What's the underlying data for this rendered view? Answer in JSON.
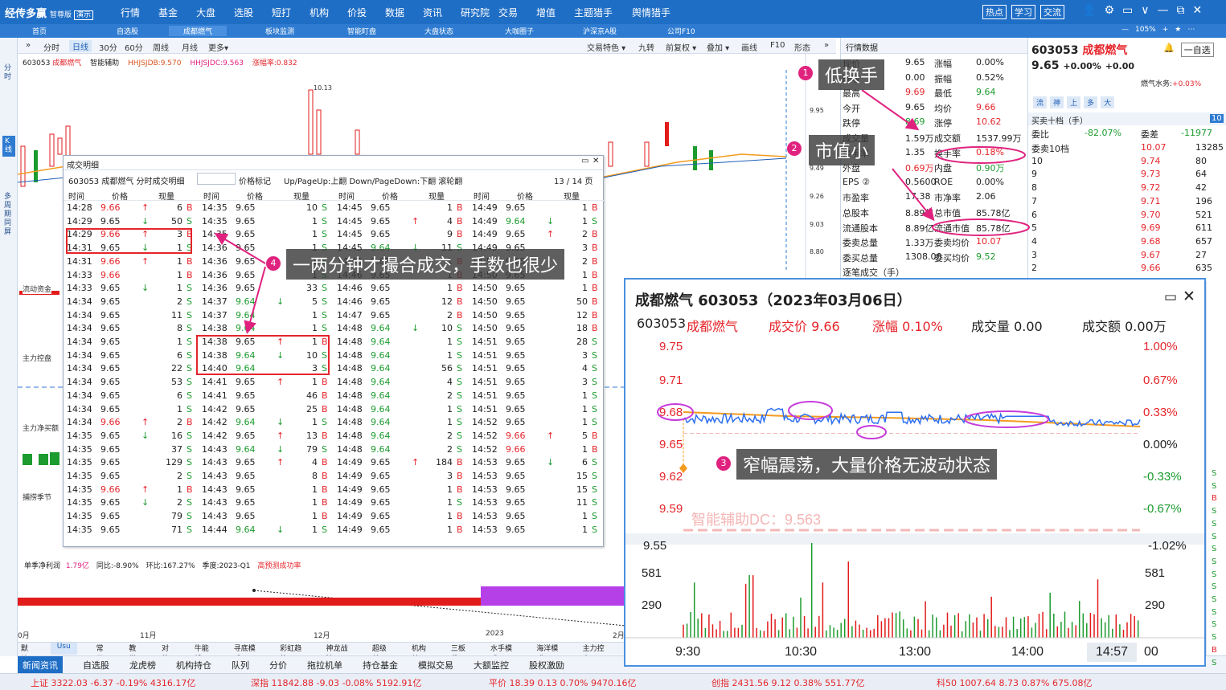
{
  "app": {
    "logo": "经传多赢",
    "edition": "智尊版",
    "demo": "演示"
  },
  "mainmenu": [
    "行情",
    "基金",
    "大盘",
    "选股",
    "短打",
    "机构",
    "价投",
    "数据",
    "资讯",
    "研究院",
    "交易",
    "增值",
    "主题猎手",
    "舆情猎手"
  ],
  "topright": [
    "热点",
    "学习",
    "交流"
  ],
  "wincontrols": [
    "👤",
    "⚙",
    "▭",
    "∨",
    "—",
    "⧉",
    "✕"
  ],
  "tabs": [
    "首页",
    "自选股",
    "成都燃气",
    "板块监测",
    "智能盯盘",
    "大盘状态",
    "大咖圈子",
    "沪深京A股",
    "公司F10"
  ],
  "zoom": "105%",
  "vleft": [
    "分时",
    "K线",
    "多周期同屏"
  ],
  "charttool": {
    "nav": "»",
    "periods": [
      "分时",
      "日线",
      "30分",
      "60分",
      "周线",
      "月线",
      "更多▾"
    ],
    "right": [
      "交易特色 ▾",
      "九转",
      "前复权 ▾",
      "叠加 ▾",
      "画线",
      "F10",
      "形态",
      "»"
    ]
  },
  "stockline": {
    "code": "603053",
    "name": "成都燃气",
    "assist": "智能辅助",
    "hj1": "HHJSJDB:9.570",
    "hj2": "HHJSJDC:9.563",
    "rate": "涨幅率:0.832"
  },
  "chartaxis": {
    "price_high": "10.13",
    "yticks": [
      "9.95",
      "9.49",
      "9.26",
      "9.03",
      "8.80"
    ],
    "months": [
      "0月",
      "11月",
      "12月",
      "2023",
      "2月"
    ]
  },
  "chartlabels": [
    "流动资金",
    "主力控盘",
    "主力净买额",
    "捕捞季节"
  ],
  "finline": {
    "a": "单季净利润",
    "b": "1.79亿",
    "c": "同比:-8.90%",
    "d": "环比:167.27%",
    "e": "季度:2023-Q1",
    "f": "高预测成功率"
  },
  "btabs": [
    "默认",
    "Usu",
    "常用",
    "教学",
    "对外",
    "牛能线",
    "寻底模式",
    "彩虹趋势",
    "神龙战法",
    "超级单",
    "机构单",
    "三板斧",
    "水手模式",
    "海洋模式",
    "主力控盘"
  ],
  "newsbar": [
    "新闻资讯",
    "自选股",
    "龙虎榜",
    "机构持仓",
    "队列",
    "分价",
    "拖拉机单",
    "持仓基金",
    "模拟交易",
    "大额监控",
    "股权激励"
  ],
  "status": [
    {
      "name": "上证",
      "v": "3322.03",
      "c": "-6.37",
      "p": "-0.19%",
      "a": "4316.17亿"
    },
    {
      "name": "深指",
      "v": "11842.88",
      "c": "-9.03",
      "p": "-0.08%",
      "a": "5192.91亿"
    },
    {
      "name": "平价",
      "v": "18.39",
      "c": "0.13",
      "p": "0.70%",
      "a": "9470.16亿"
    },
    {
      "name": "创指",
      "v": "2431.56",
      "c": "9.12",
      "p": "0.38%",
      "a": "551.77亿"
    },
    {
      "name": "科50",
      "v": "1007.64",
      "c": "8.73",
      "p": "0.87%",
      "a": "675.08亿"
    }
  ],
  "quote": {
    "head": "行情数据",
    "rows": [
      [
        "现价",
        "9.65",
        "涨幅",
        "0.00%"
      ],
      [
        "昨收",
        "0.00",
        "振幅",
        "0.52%"
      ],
      [
        "最高",
        "9.69",
        "最低",
        "9.64"
      ],
      [
        "今开",
        "9.65",
        "均价",
        "9.66"
      ],
      [
        "跌停",
        "8.69",
        "涨停",
        "10.62"
      ],
      [
        "成交量",
        "1.59万",
        "成交额",
        "1537.99万"
      ],
      [
        "换手率",
        "1.35",
        "换手率",
        "0.18%"
      ],
      [
        "外盘",
        "0.69万",
        "内盘",
        "0.90万"
      ],
      [
        "EPS ②",
        "0.5600",
        "ROE",
        "0.00%"
      ],
      [
        "市盈率",
        "17.38",
        "市净率",
        "2.06"
      ],
      [
        "总股本",
        "8.89亿",
        "总市值",
        "85.78亿"
      ],
      [
        "流通股本",
        "8.89亿",
        "流通市值",
        "85.78亿"
      ],
      [
        "委卖总量",
        "1.33万",
        "委卖均价",
        "10.07"
      ],
      [
        "委买总量",
        "1308.00",
        "委买均价",
        "9.52"
      ],
      [
        "逐笔成交（手）",
        "",
        "",
        ""
      ]
    ]
  },
  "right": {
    "code": "603053",
    "name": "成都燃气",
    "price": "9.65",
    "chg": "+0.00%",
    "chgv": "+0.00",
    "btn1": "🔔",
    "btn2": "一自选",
    "feed": "燃气水务:",
    "feedv": "+0.03%",
    "tabs": [
      "流",
      "神",
      "上",
      "多",
      "大"
    ],
    "obhead": "买卖十档（手）",
    "obhead_n": "10",
    "wb": "委比",
    "wbv": "-82.07%",
    "wc": "委差",
    "wcv": "-11977",
    "book": [
      [
        "委卖10档",
        "10.07",
        "13285"
      ],
      [
        "10",
        "9.74",
        "80"
      ],
      [
        "9",
        "9.73",
        "64"
      ],
      [
        "8",
        "9.72",
        "42"
      ],
      [
        "7",
        "9.71",
        "196"
      ],
      [
        "6",
        "9.70",
        "521"
      ],
      [
        "5",
        "9.69",
        "611"
      ],
      [
        "4",
        "9.68",
        "657"
      ],
      [
        "3",
        "9.67",
        "27"
      ],
      [
        "2",
        "9.66",
        "635"
      ]
    ]
  },
  "rightstrip": [
    "S",
    "S",
    "B",
    "S",
    "S",
    "S",
    "S",
    "S",
    "S",
    "S",
    "S",
    "S",
    "S",
    "S",
    "B",
    "S"
  ],
  "dlg": {
    "title": "成交明细",
    "sub": "603053 成都燃气  分时成交明细",
    "pricemark": "价格标记",
    "hint": "Up/PageUp:上翻 Down/PageDown:下翻 滚轮翻",
    "page": "13 / 14 页",
    "headers": [
      "时间",
      "价格",
      "现量"
    ],
    "cols": [
      [
        [
          "14:28",
          "9.66",
          "↑",
          "6",
          "B"
        ],
        [
          "14:29",
          "9.65",
          "↓",
          "50",
          "S"
        ],
        [
          "14:29",
          "9.66",
          "↑",
          "3",
          "B"
        ],
        [
          "14:31",
          "9.65",
          "↓",
          "1",
          "S"
        ],
        [
          "14:31",
          "9.66",
          "↑",
          "1",
          "B"
        ],
        [
          "14:33",
          "9.66",
          "",
          "1",
          "B"
        ],
        [
          "14:33",
          "9.65",
          "↓",
          "1",
          "S"
        ],
        [
          "14:34",
          "9.65",
          "",
          "2",
          "S"
        ],
        [
          "14:34",
          "9.65",
          "",
          "11",
          "S"
        ],
        [
          "14:34",
          "9.65",
          "",
          "8",
          "S"
        ],
        [
          "14:34",
          "9.65",
          "",
          "1",
          "S"
        ],
        [
          "14:34",
          "9.65",
          "",
          "6",
          "S"
        ],
        [
          "14:34",
          "9.65",
          "",
          "22",
          "S"
        ],
        [
          "14:34",
          "9.65",
          "",
          "53",
          "S"
        ],
        [
          "14:34",
          "9.65",
          "",
          "6",
          "S"
        ],
        [
          "14:34",
          "9.65",
          "",
          "1",
          "S"
        ],
        [
          "14:34",
          "9.66",
          "↑",
          "2",
          "B"
        ],
        [
          "14:35",
          "9.65",
          "↓",
          "16",
          "S"
        ],
        [
          "14:35",
          "9.65",
          "",
          "37",
          "S"
        ],
        [
          "14:35",
          "9.65",
          "",
          "129",
          "S"
        ],
        [
          "14:35",
          "9.65",
          "",
          "2",
          "S"
        ],
        [
          "14:35",
          "9.66",
          "↑",
          "1",
          "B"
        ],
        [
          "14:35",
          "9.65",
          "↓",
          "2",
          "S"
        ],
        [
          "14:35",
          "9.65",
          "",
          "79",
          "S"
        ],
        [
          "14:35",
          "9.65",
          "",
          "71",
          "S"
        ]
      ],
      [
        [
          "14:35",
          "9.65",
          "",
          "10",
          "S"
        ],
        [
          "14:35",
          "9.65",
          "",
          "1",
          "S"
        ],
        [
          "14:35",
          "9.65",
          "",
          "1",
          "S"
        ],
        [
          "14:36",
          "9.65",
          "",
          "1",
          "S"
        ],
        [
          "14:36",
          "9.65",
          "",
          "1",
          "S"
        ],
        [
          "14:36",
          "9.65",
          "",
          "1",
          "S"
        ],
        [
          "14:36",
          "9.65",
          "",
          "33",
          "S"
        ],
        [
          "14:37",
          "9.64",
          "↓",
          "5",
          "S"
        ],
        [
          "14:37",
          "9.64",
          "",
          "1",
          "S"
        ],
        [
          "14:38",
          "9.64",
          "",
          "1",
          "S"
        ],
        [
          "14:38",
          "9.65",
          "↑",
          "1",
          "B"
        ],
        [
          "14:38",
          "9.64",
          "↓",
          "10",
          "S"
        ],
        [
          "14:40",
          "9.64",
          "",
          "3",
          "S"
        ],
        [
          "14:41",
          "9.65",
          "↑",
          "1",
          "B"
        ],
        [
          "14:41",
          "9.65",
          "",
          "46",
          "B"
        ],
        [
          "14:42",
          "9.65",
          "",
          "25",
          "B"
        ],
        [
          "14:42",
          "9.64",
          "↓",
          "1",
          "S"
        ],
        [
          "14:42",
          "9.65",
          "↑",
          "13",
          "B"
        ],
        [
          "14:43",
          "9.64",
          "↓",
          "79",
          "S"
        ],
        [
          "14:43",
          "9.65",
          "↑",
          "4",
          "B"
        ],
        [
          "14:43",
          "9.65",
          "",
          "8",
          "B"
        ],
        [
          "14:43",
          "9.65",
          "",
          "1",
          "B"
        ],
        [
          "14:43",
          "9.65",
          "",
          "1",
          "B"
        ],
        [
          "14:43",
          "9.65",
          "",
          "1",
          "B"
        ],
        [
          "14:44",
          "9.64",
          "↓",
          "1",
          "S"
        ]
      ],
      [
        [
          "14:45",
          "9.65",
          "",
          "1",
          "B"
        ],
        [
          "14:45",
          "9.65",
          "↑",
          "4",
          "B"
        ],
        [
          "14:45",
          "9.65",
          "",
          "9",
          "B"
        ],
        [
          "14:45",
          "9.64",
          "↓",
          "11",
          "S"
        ],
        [
          "14:45",
          "9.65",
          "",
          "1",
          "B"
        ],
        [
          "14:46",
          "9.65",
          "",
          "1",
          "B"
        ],
        [
          "14:46",
          "9.65",
          "",
          "1",
          "B"
        ],
        [
          "14:46",
          "9.65",
          "",
          "12",
          "B"
        ],
        [
          "14:47",
          "9.65",
          "",
          "2",
          "B"
        ],
        [
          "14:48",
          "9.64",
          "↓",
          "10",
          "S"
        ],
        [
          "14:48",
          "9.64",
          "",
          "1",
          "S"
        ],
        [
          "14:48",
          "9.64",
          "",
          "1",
          "S"
        ],
        [
          "14:48",
          "9.64",
          "",
          "56",
          "S"
        ],
        [
          "14:48",
          "9.64",
          "",
          "4",
          "S"
        ],
        [
          "14:48",
          "9.64",
          "",
          "2",
          "S"
        ],
        [
          "14:48",
          "9.64",
          "",
          "1",
          "S"
        ],
        [
          "14:48",
          "9.64",
          "",
          "1",
          "S"
        ],
        [
          "14:48",
          "9.64",
          "",
          "2",
          "S"
        ],
        [
          "14:48",
          "9.64",
          "",
          "2",
          "S"
        ],
        [
          "14:49",
          "9.65",
          "↑",
          "184",
          "B"
        ],
        [
          "14:49",
          "9.65",
          "",
          "3",
          "B"
        ],
        [
          "14:49",
          "9.65",
          "",
          "1",
          "B"
        ],
        [
          "14:49",
          "9.65",
          "",
          "1",
          "S"
        ],
        [
          "14:49",
          "9.65",
          "",
          "1",
          "B"
        ],
        [
          "14:49",
          "9.65",
          "",
          "1",
          "B"
        ]
      ],
      [
        [
          "14:49",
          "9.65",
          "",
          "1",
          "B"
        ],
        [
          "14:49",
          "9.64",
          "↓",
          "1",
          "S"
        ],
        [
          "14:49",
          "9.65",
          "↑",
          "2",
          "B"
        ],
        [
          "14:49",
          "9.65",
          "",
          "3",
          "B"
        ],
        [
          "14:50",
          "9.65",
          "",
          "2",
          "B"
        ],
        [
          "14:50",
          "9.65",
          "",
          "1",
          "B"
        ],
        [
          "14:50",
          "9.65",
          "",
          "1",
          "B"
        ],
        [
          "14:50",
          "9.65",
          "",
          "50",
          "B"
        ],
        [
          "14:50",
          "9.65",
          "",
          "12",
          "B"
        ],
        [
          "14:50",
          "9.65",
          "",
          "18",
          "B"
        ],
        [
          "14:51",
          "9.65",
          "",
          "28",
          "S"
        ],
        [
          "14:51",
          "9.65",
          "",
          "3",
          "S"
        ],
        [
          "14:51",
          "9.65",
          "",
          "4",
          "S"
        ],
        [
          "14:51",
          "9.65",
          "",
          "3",
          "S"
        ],
        [
          "14:51",
          "9.65",
          "",
          "1",
          "S"
        ],
        [
          "14:51",
          "9.65",
          "",
          "1",
          "S"
        ],
        [
          "14:52",
          "9.65",
          "",
          "1",
          "S"
        ],
        [
          "14:52",
          "9.66",
          "↑",
          "5",
          "B"
        ],
        [
          "14:52",
          "9.66",
          "",
          "1",
          "B"
        ],
        [
          "14:53",
          "9.65",
          "↓",
          "6",
          "S"
        ],
        [
          "14:53",
          "9.65",
          "",
          "15",
          "S"
        ],
        [
          "14:53",
          "9.65",
          "",
          "15",
          "S"
        ],
        [
          "14:53",
          "9.65",
          "",
          "11",
          "S"
        ],
        [
          "14:53",
          "9.65",
          "",
          "1",
          "S"
        ],
        [
          "14:53",
          "9.65",
          "",
          "1",
          "S"
        ]
      ]
    ]
  },
  "ann": {
    "a1": "低换手",
    "a2": "市值小",
    "a3": "窄幅震荡，大量价格无波动状态",
    "a4": "一两分钟才撮合成交，手数也很少",
    "n1": "1",
    "n2": "2",
    "n3": "3",
    "n4": "4"
  },
  "mini": {
    "title": "成都燃气 603053（2023年03月06日）",
    "code": "603053",
    "name": "成都燃气",
    "deal": "成交价 9.66",
    "chg": "涨幅 0.10%",
    "vol": "成交量 0.00",
    "amt": "成交额 0.00万",
    "yl": [
      "9.75",
      "9.71",
      "9.68",
      "9.65",
      "9.62",
      "9.59",
      "9.55"
    ],
    "yr": [
      "1.00%",
      "0.67%",
      "0.33%",
      "0.00%",
      "-0.33%",
      "-0.67%",
      "-1.02%"
    ],
    "vyl": [
      "581",
      "290"
    ],
    "xt": [
      "9:30",
      "10:30",
      "13:00",
      "14:00",
      "14:57",
      "00"
    ],
    "dc": "智能辅助DC：9.563"
  },
  "chart_data": {
    "type": "line",
    "title": "成都燃气 603053（2023年03月06日）",
    "xlabel": "",
    "ylabel": "",
    "ylim": [
      9.55,
      9.75
    ],
    "categories": [
      "9:30",
      "10:30",
      "13:00",
      "14:00",
      "14:57"
    ],
    "series": [
      {
        "name": "",
        "values": [
          9.66,
          9.67,
          9.66,
          9.66,
          9.65
        ]
      }
    ]
  }
}
